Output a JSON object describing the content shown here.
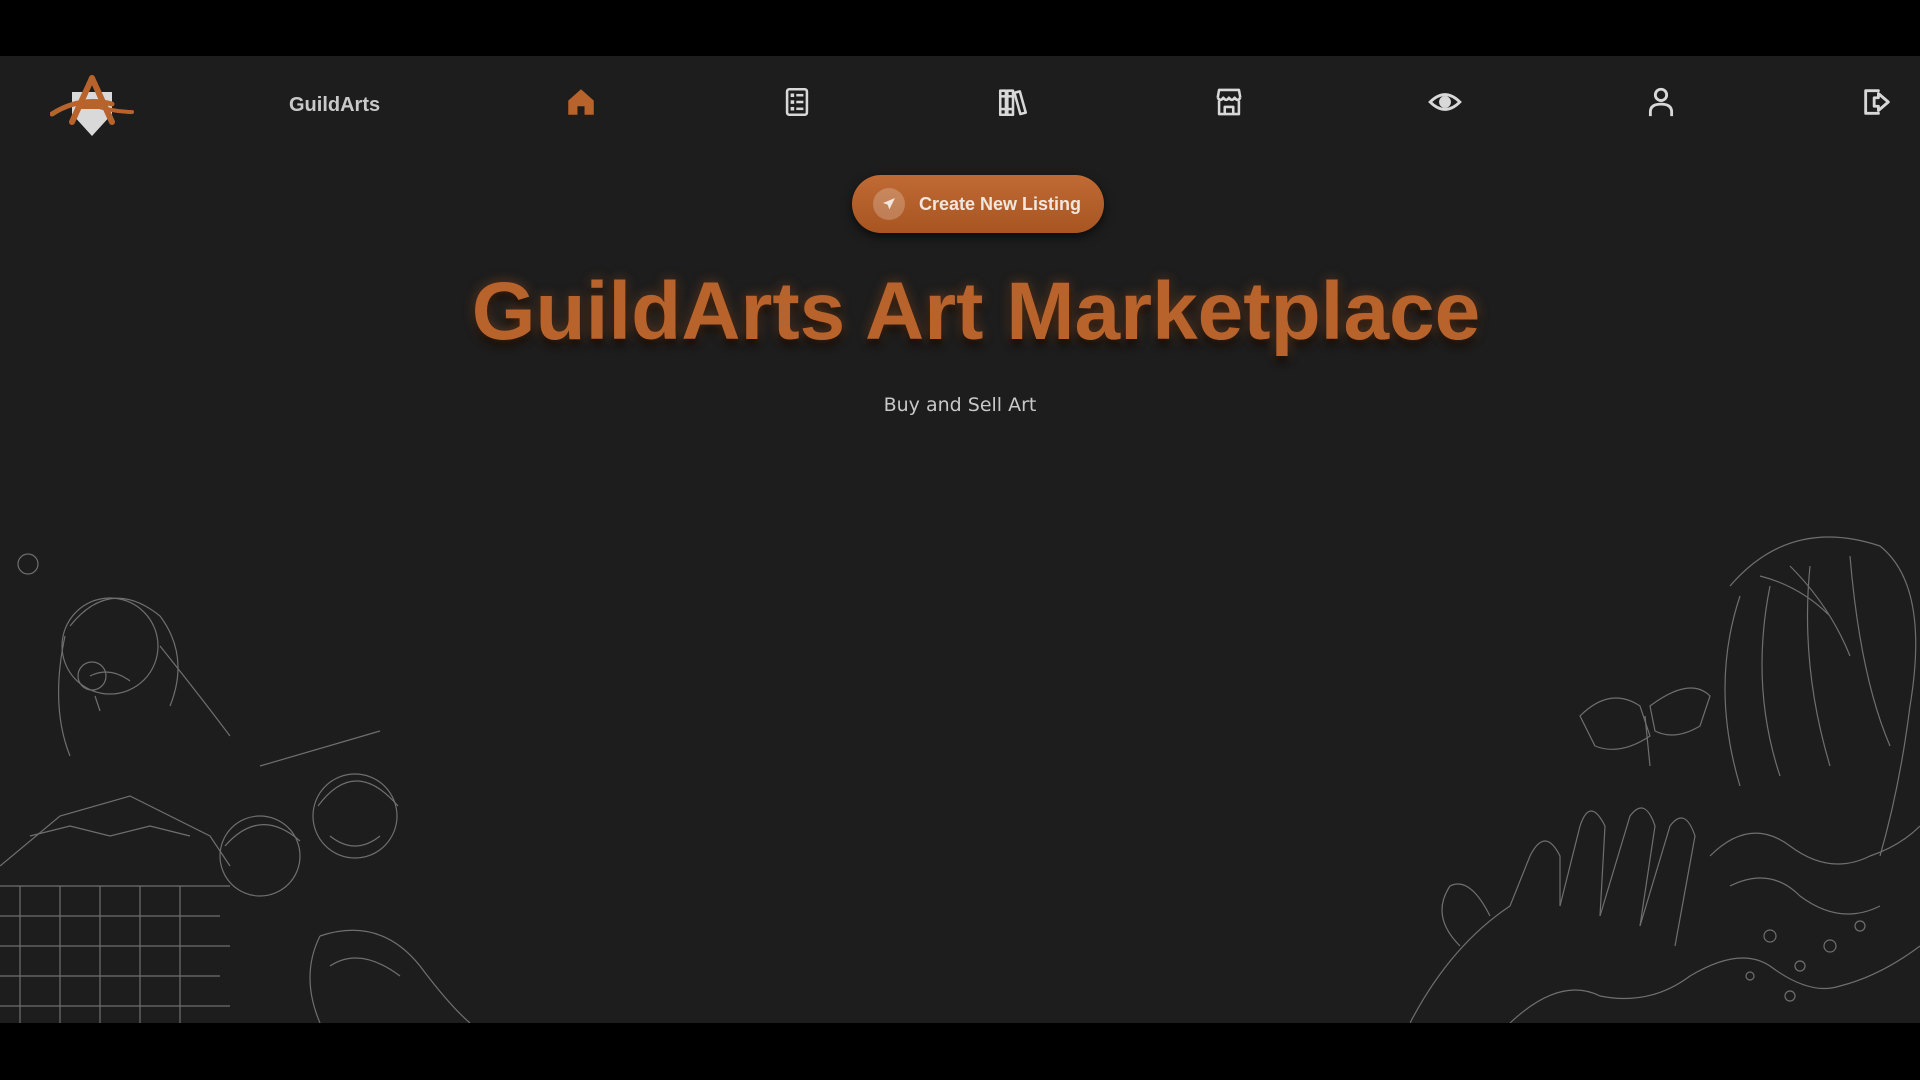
{
  "nav": {
    "brand": "GuildArts",
    "icons": [
      "home-icon",
      "listings-icon",
      "library-icon",
      "store-icon",
      "eye-icon",
      "profile-icon",
      "logout-icon"
    ],
    "active": "home"
  },
  "actions": {
    "create_label": "Create New Listing"
  },
  "hero": {
    "title": "GuildArts Art Marketplace",
    "subtitle": "Buy and Sell Art"
  },
  "colors": {
    "accent": "#b8632c",
    "background": "#1d1d1d",
    "icon": "#d8d8d8"
  }
}
